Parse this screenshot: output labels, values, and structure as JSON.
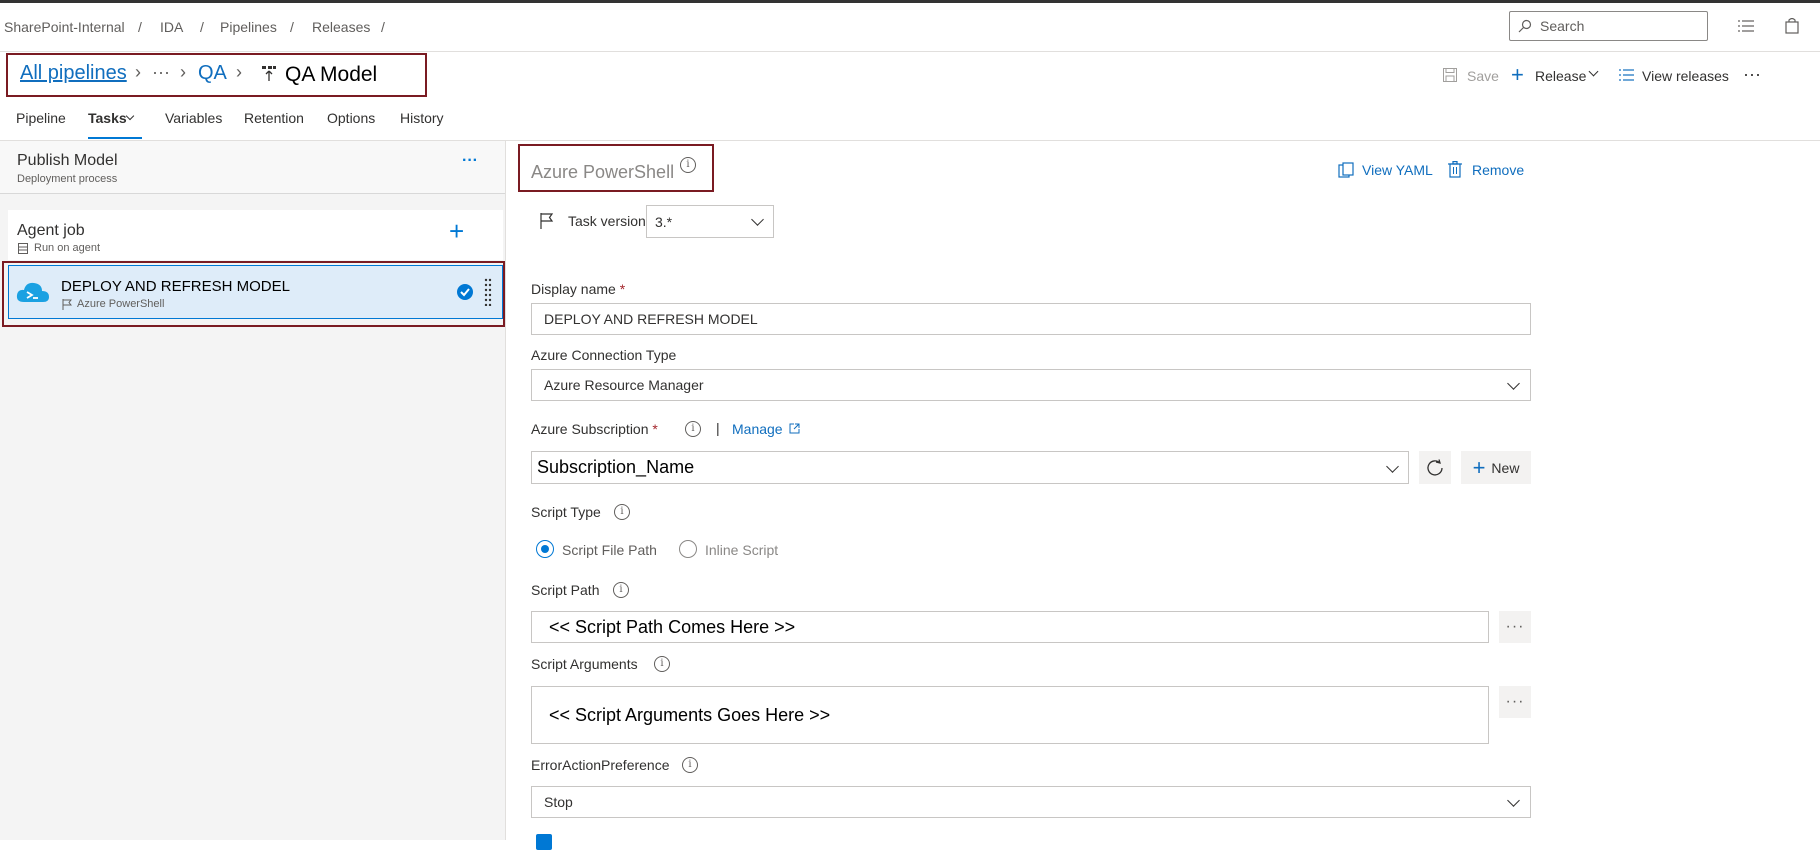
{
  "breadcrumb": {
    "items": [
      "SharePoint-Internal",
      "IDA",
      "Pipelines",
      "Releases"
    ],
    "separator": "/"
  },
  "search": {
    "placeholder": "Search"
  },
  "title_bar": {
    "all_pipelines": "All pipelines",
    "more": "···",
    "folder": "QA",
    "pipeline_name": "QA Model"
  },
  "toolbar": {
    "save": "Save",
    "release": "Release",
    "view_releases": "View releases",
    "more": "···"
  },
  "tabs": [
    "Pipeline",
    "Tasks",
    "Variables",
    "Retention",
    "Options",
    "History"
  ],
  "stage": {
    "name": "Publish Model",
    "subtitle": "Deployment process",
    "more": "···"
  },
  "agent_job": {
    "name": "Agent job",
    "subtitle": "Run on agent"
  },
  "task": {
    "name": "DEPLOY AND REFRESH MODEL",
    "type": "Azure PowerShell"
  },
  "detail": {
    "title": "Azure PowerShell",
    "view_yaml": "View YAML",
    "remove": "Remove",
    "task_version_label": "Task version",
    "task_version_value": "3.*",
    "display_name_label": "Display name",
    "required_mark": "*",
    "display_name_value": "DEPLOY AND REFRESH MODEL",
    "connection_type_label": "Azure Connection Type",
    "connection_type_value": "Azure Resource Manager",
    "subscription_label": "Azure Subscription",
    "pipe": "|",
    "manage": "Manage",
    "subscription_value": "Subscription_Name",
    "new": "New",
    "script_type_label": "Script Type",
    "script_type_options": [
      "Script File Path",
      "Inline Script"
    ],
    "script_type_selected": "Script File Path",
    "script_path_label": "Script Path",
    "script_path_value": "<< Script Path Comes Here >>",
    "script_args_label": "Script Arguments",
    "script_args_value": "<< Script Arguments Goes Here >>",
    "error_pref_label": "ErrorActionPreference",
    "error_pref_value": "Stop"
  },
  "colors": {
    "accent": "#0078d4",
    "highlight_border": "#7a1b22",
    "selected_row": "#deecf9",
    "required": "#a4262c"
  }
}
